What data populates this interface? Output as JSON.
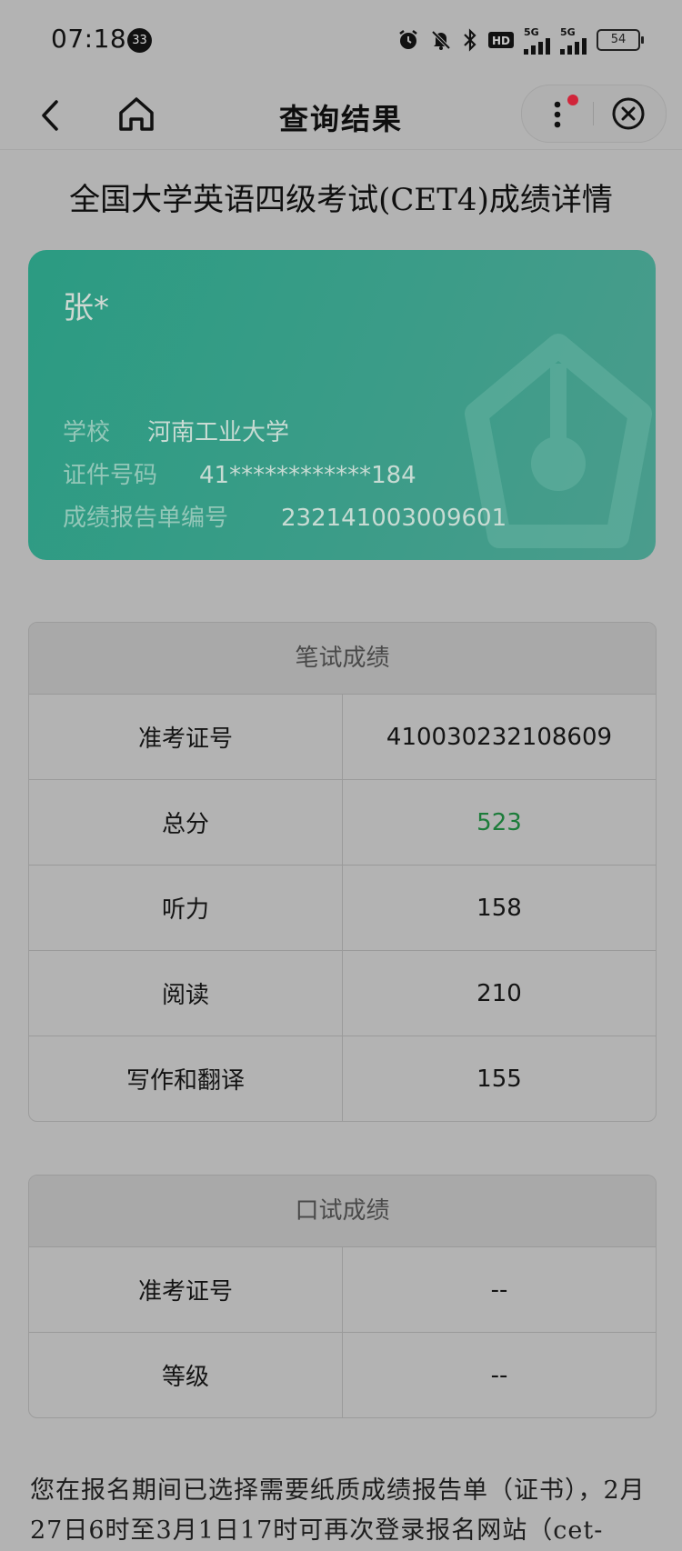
{
  "status_bar": {
    "time": "07:18",
    "notification_count": "33",
    "network_1": "5G",
    "network_2": "5G",
    "hd_label": "HD",
    "battery": "54"
  },
  "nav": {
    "title": "查询结果",
    "icons": [
      "back-icon",
      "home-icon",
      "more-icon",
      "close-icon"
    ]
  },
  "page_heading": "全国大学英语四级考试(CET4)成绩详情",
  "card": {
    "name": "张*",
    "school_label": "学校",
    "school_value": "河南工业大学",
    "id_label": "证件号码",
    "id_value": "41************184",
    "report_label": "成绩报告单编号",
    "report_value": "232141003009601",
    "accent": "#2b9b82"
  },
  "written": {
    "header": "笔试成绩",
    "rows": [
      {
        "label": "准考证号",
        "value": "410030232108609"
      },
      {
        "label": "总分",
        "value": "523"
      },
      {
        "label": "听力",
        "value": "158"
      },
      {
        "label": "阅读",
        "value": "210"
      },
      {
        "label": "写作和翻译",
        "value": "155"
      }
    ]
  },
  "oral": {
    "header": "口试成绩",
    "rows": [
      {
        "label": "准考证号",
        "value": "--"
      },
      {
        "label": "等级",
        "value": "--"
      }
    ]
  },
  "note": "您在报名期间已选择需要纸质成绩报告单（证书），2月27日6时至3月1日17时可再次登录报名网站（cet-"
}
